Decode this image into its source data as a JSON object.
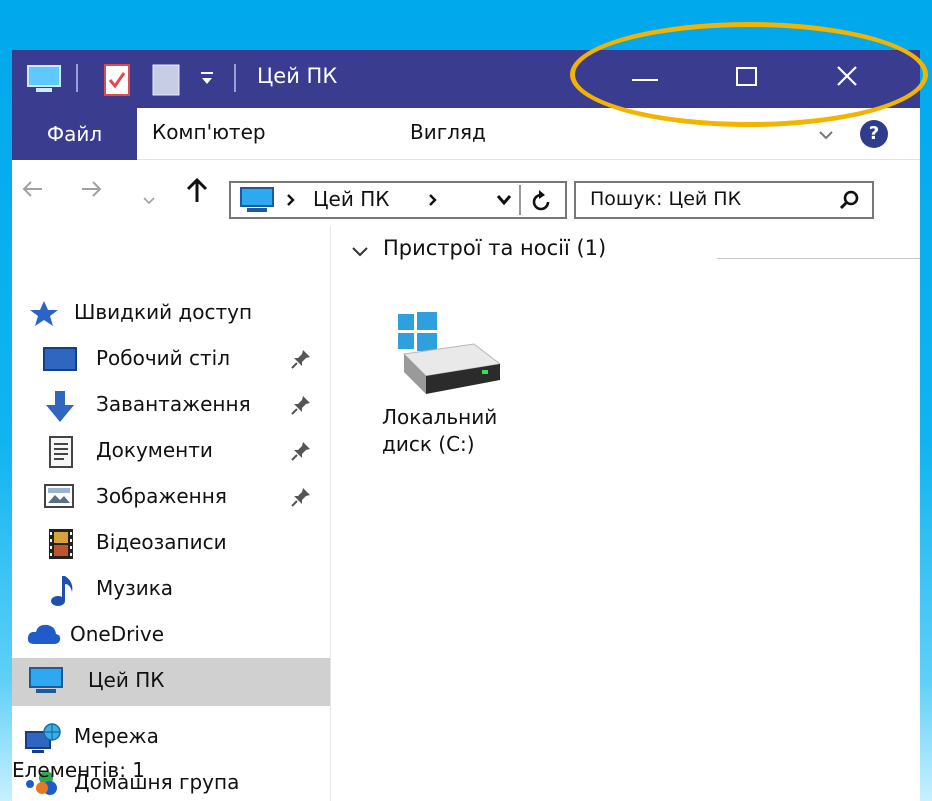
{
  "window": {
    "title": "Цей ПК"
  },
  "ribbon": {
    "tabs": [
      "Файл",
      "Комп'ютер",
      "Вигляд"
    ],
    "help_label": "?"
  },
  "address": {
    "segments": [
      "Цей ПК"
    ]
  },
  "search": {
    "placeholder": "Пошук: Цей ПК"
  },
  "nav": {
    "quick_access": "Швидкий доступ",
    "items": [
      {
        "label": "Робочий стіл",
        "pinned": true
      },
      {
        "label": "Завантаження",
        "pinned": true
      },
      {
        "label": "Документи",
        "pinned": true
      },
      {
        "label": "Зображення",
        "pinned": true
      },
      {
        "label": "Відеозаписи",
        "pinned": false
      },
      {
        "label": "Музика",
        "pinned": false
      }
    ],
    "onedrive": "OneDrive",
    "this_pc": "Цей ПК",
    "network": "Мережа",
    "homegroup": "Домашня група"
  },
  "status": {
    "text": "Елементів: 1"
  },
  "content": {
    "group_title": "Пристрої та носії (1)",
    "drive": {
      "label_line1": "Локальний",
      "label_line2": "диск (C:)"
    }
  },
  "colors": {
    "titlebar": "#3a3d8f",
    "highlight": "#f2b400",
    "background": "#00a8ec",
    "selected": "#d0d0d0"
  }
}
